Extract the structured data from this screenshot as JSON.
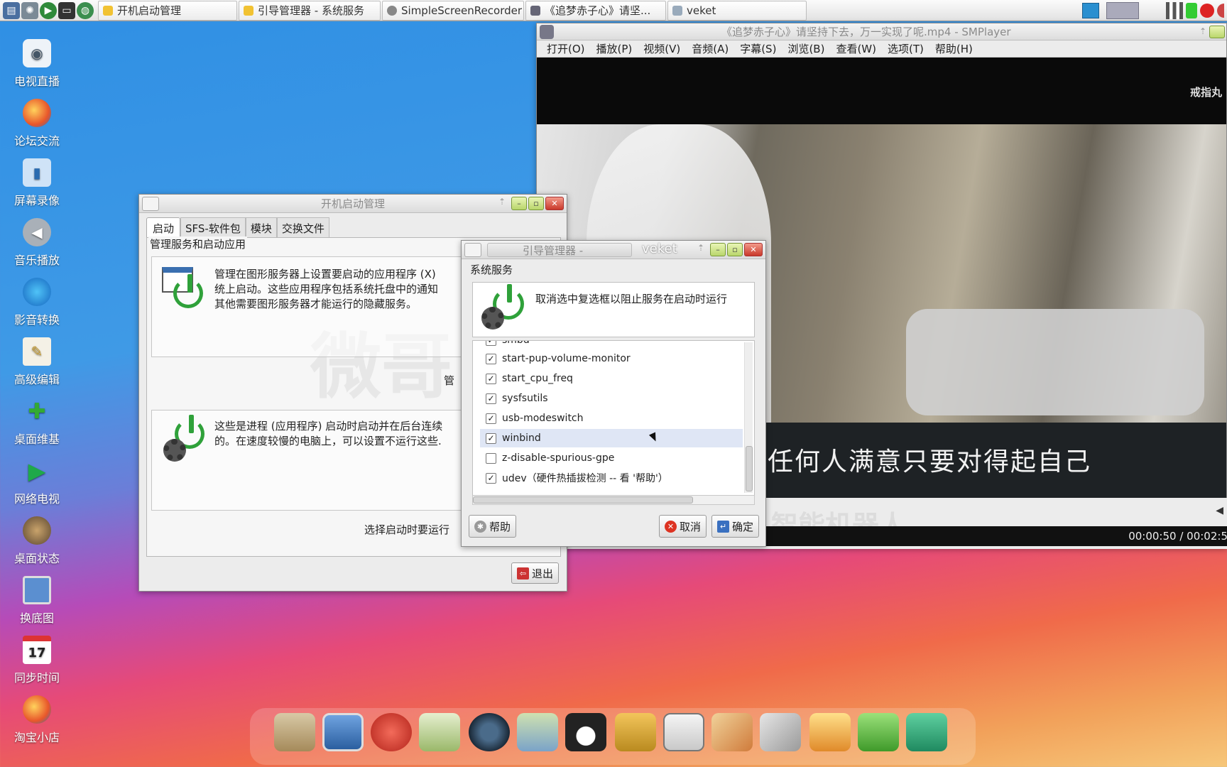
{
  "taskbar": {
    "tasks": [
      "开机启动管理",
      "引导管理器 - 系统服务",
      "SimpleScreenRecorder",
      "《追梦赤子心》请坚...",
      "veket"
    ]
  },
  "desktop": {
    "icons": [
      "电视直播",
      "论坛交流",
      "屏幕录像",
      "音乐播放",
      "影音转换",
      "高级编辑",
      "桌面维基",
      "网络电视",
      "桌面状态",
      "换底图",
      "同步时间",
      "淘宝小店"
    ],
    "calendar_day": "17"
  },
  "player": {
    "title": "《追梦赤子心》请坚持下去，万一实现了呢.mp4 - SMPlayer",
    "menu": [
      "打开(O)",
      "播放(P)",
      "视频(V)",
      "音频(A)",
      "字幕(S)",
      "浏览(B)",
      "查看(W)",
      "选项(T)",
      "帮助(H)"
    ],
    "watermark": "戒指丸",
    "subtitle": "任何人满意只要对得起自己",
    "time": "00:00:50 / 00:02:5",
    "bg_text": "智能机器人"
  },
  "startup": {
    "title": "开机启动管理",
    "tabs": [
      "启动",
      "SFS-软件包",
      "模块",
      "交换文件"
    ],
    "group_label": "管理服务和启动应用",
    "desc1_line1": "管理在图形服务器上设置要启动的应用程序 (X)",
    "desc1_line2": "统上启动。这些应用程序包括系统托盘中的通知",
    "desc1_line3": "其他需要图形服务器才能运行的隐藏服务。",
    "manage_label": "管",
    "desc2_line1": "这些是进程 (应用程序) 启动时启动并在后台连续",
    "desc2_line2": "的。在速度较慢的电脑上，可以设置不运行这些.",
    "choose_label": "选择启动时要运行",
    "quit_label": "退出",
    "bg_text": "微哥"
  },
  "services": {
    "title": "引导管理器 - ",
    "title_extra": "veket",
    "group_label": "系统服务",
    "hint": "取消选中复选框以阻止服务在启动时运行",
    "items": [
      {
        "label": "smbd",
        "checked": true
      },
      {
        "label": "start-pup-volume-monitor",
        "checked": true
      },
      {
        "label": "start_cpu_freq",
        "checked": true
      },
      {
        "label": "sysfsutils",
        "checked": true
      },
      {
        "label": "usb-modeswitch",
        "checked": true
      },
      {
        "label": "winbind",
        "checked": true
      },
      {
        "label": "z-disable-spurious-gpe",
        "checked": false
      },
      {
        "label": "udev（硬件热插拔检测 -- 看 '帮助'）",
        "checked": true
      }
    ],
    "help_label": "帮助",
    "cancel_label": "取消",
    "ok_label": "确定"
  }
}
